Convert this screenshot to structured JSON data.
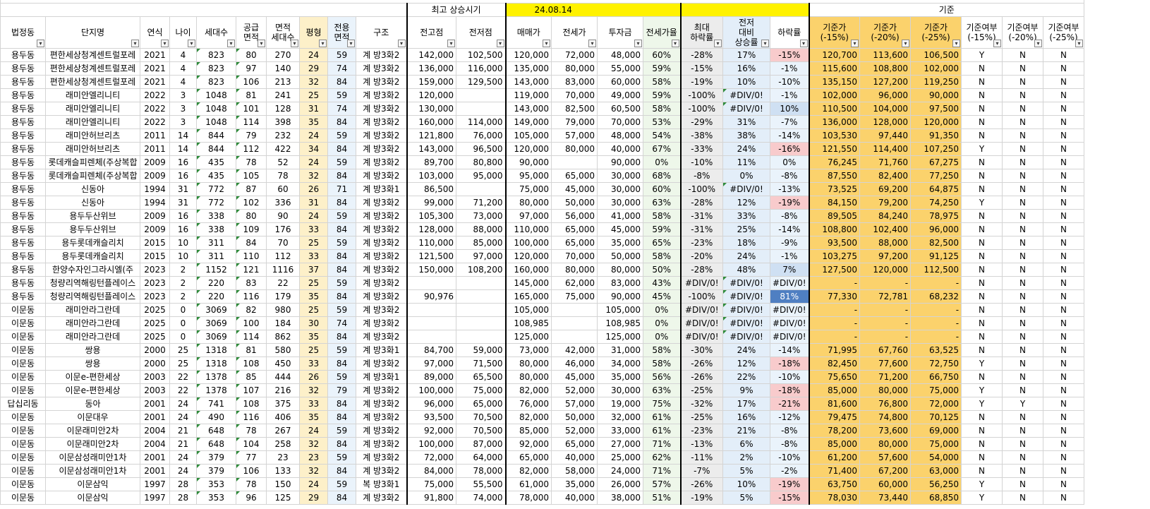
{
  "top_labels": {
    "peak_label": "최고 상승시기",
    "date": "24.08.14",
    "base_label": "기준"
  },
  "headers": [
    "법정동",
    "단지명",
    "연식",
    "나이",
    "세대수",
    "공급\n면적",
    "면적\n세대수",
    "평형",
    "전용\n면적",
    "구조",
    "전고점",
    "전저점",
    "매매가",
    "전세가",
    "투자금",
    "전세가율",
    "최대\n하락률",
    "전저\n대비\n상승률",
    "하락률",
    "기준가\n(-15%)",
    "기준가\n(-20%)",
    "기준가\n(-25%)",
    "기준여부\n(-15%)",
    "기준여부\n(-20%)",
    "기준여부\n(-25%)"
  ],
  "filter_icon": "filter-dropdown-icon",
  "colors": {
    "pyeong": "#fdf0c9",
    "jeonyong": "#eaf3fb",
    "highlight": "#fff200",
    "ratio": "#eef7ea",
    "base": "#fbd26c",
    "drop_pink": "#f8cbcc",
    "drop_blue": "#cfe0f3",
    "drop_dark": "#4f7fc2"
  },
  "rows": [
    [
      "용두동",
      "편한세상청계센트럴포레",
      "2021",
      "4",
      "823",
      "80",
      "270",
      "24",
      "59",
      "계 방3화2",
      "142,000",
      "102,500",
      "120,000",
      "72,000",
      "48,000",
      "60%",
      "-28%",
      "17%",
      "-15%",
      "120,700",
      "113,600",
      "106,500",
      "Y",
      "N",
      "N"
    ],
    [
      "용두동",
      "편한세상청계센트럴포레",
      "2021",
      "4",
      "823",
      "97",
      "140",
      "29",
      "74",
      "계 방3화2",
      "136,000",
      "116,000",
      "135,000",
      "80,000",
      "55,000",
      "59%",
      "-15%",
      "16%",
      "-1%",
      "115,600",
      "108,800",
      "102,000",
      "N",
      "N",
      "N"
    ],
    [
      "용두동",
      "편한세상청계센트럴포레",
      "2021",
      "4",
      "823",
      "106",
      "213",
      "32",
      "84",
      "계 방3화2",
      "159,000",
      "129,500",
      "143,000",
      "83,000",
      "60,000",
      "58%",
      "-19%",
      "10%",
      "-10%",
      "135,150",
      "127,200",
      "119,250",
      "N",
      "N",
      "N"
    ],
    [
      "용두동",
      "래미안엘리니티",
      "2022",
      "3",
      "1048",
      "81",
      "241",
      "25",
      "59",
      "계 방3화2",
      "120,000",
      "",
      "119,000",
      "70,000",
      "49,000",
      "59%",
      "-100%",
      "#DIV/0!",
      "-1%",
      "102,000",
      "96,000",
      "90,000",
      "N",
      "N",
      "N"
    ],
    [
      "용두동",
      "래미안엘리니티",
      "2022",
      "3",
      "1048",
      "101",
      "128",
      "31",
      "74",
      "계 방3화2",
      "130,000",
      "",
      "143,000",
      "82,500",
      "60,500",
      "58%",
      "-100%",
      "#DIV/0!",
      "10%",
      "110,500",
      "104,000",
      "97,500",
      "N",
      "N",
      "N"
    ],
    [
      "용두동",
      "래미안엘리니티",
      "2022",
      "3",
      "1048",
      "114",
      "398",
      "35",
      "84",
      "계 방3화2",
      "160,000",
      "114,000",
      "149,000",
      "79,000",
      "70,000",
      "53%",
      "-29%",
      "31%",
      "-7%",
      "136,000",
      "128,000",
      "120,000",
      "N",
      "N",
      "N"
    ],
    [
      "용두동",
      "래미안허브리츠",
      "2011",
      "14",
      "844",
      "79",
      "232",
      "24",
      "59",
      "계 방3화2",
      "121,800",
      "76,000",
      "105,000",
      "57,000",
      "48,000",
      "54%",
      "-38%",
      "38%",
      "-14%",
      "103,530",
      "97,440",
      "91,350",
      "N",
      "N",
      "N"
    ],
    [
      "용두동",
      "래미안허브리츠",
      "2011",
      "14",
      "844",
      "112",
      "422",
      "34",
      "84",
      "계 방3화2",
      "143,000",
      "96,500",
      "120,000",
      "80,000",
      "40,000",
      "67%",
      "-33%",
      "24%",
      "-16%",
      "121,550",
      "114,400",
      "107,250",
      "Y",
      "N",
      "N"
    ],
    [
      "용두동",
      "롯데캐슬피렌체(주상복합",
      "2009",
      "16",
      "435",
      "78",
      "52",
      "24",
      "59",
      "계 방3화2",
      "89,700",
      "80,800",
      "90,000",
      "",
      "90,000",
      "0%",
      "-10%",
      "11%",
      "0%",
      "76,245",
      "71,760",
      "67,275",
      "N",
      "N",
      "N"
    ],
    [
      "용두동",
      "롯데캐슬피렌체(주상복합",
      "2009",
      "16",
      "435",
      "105",
      "78",
      "32",
      "84",
      "계 방3화2",
      "103,000",
      "95,000",
      "95,000",
      "65,000",
      "30,000",
      "68%",
      "-8%",
      "0%",
      "-8%",
      "87,550",
      "82,400",
      "77,250",
      "N",
      "N",
      "N"
    ],
    [
      "용두동",
      "신동아",
      "1994",
      "31",
      "772",
      "87",
      "60",
      "26",
      "71",
      "계 방3화1",
      "86,500",
      "",
      "75,000",
      "45,000",
      "30,000",
      "60%",
      "-100%",
      "#DIV/0!",
      "-13%",
      "73,525",
      "69,200",
      "64,875",
      "N",
      "N",
      "N"
    ],
    [
      "용두동",
      "신동아",
      "1994",
      "31",
      "772",
      "102",
      "336",
      "31",
      "84",
      "계 방3화2",
      "99,000",
      "71,200",
      "80,000",
      "50,000",
      "30,000",
      "63%",
      "-28%",
      "12%",
      "-19%",
      "84,150",
      "79,200",
      "74,250",
      "Y",
      "N",
      "N"
    ],
    [
      "용두동",
      "용두두산위브",
      "2009",
      "16",
      "338",
      "80",
      "90",
      "24",
      "59",
      "계 방3화2",
      "105,300",
      "73,000",
      "97,000",
      "56,000",
      "41,000",
      "58%",
      "-31%",
      "33%",
      "-8%",
      "89,505",
      "84,240",
      "78,975",
      "N",
      "N",
      "N"
    ],
    [
      "용두동",
      "용두두산위브",
      "2009",
      "16",
      "338",
      "109",
      "176",
      "33",
      "84",
      "계 방3화2",
      "128,000",
      "88,000",
      "110,000",
      "65,000",
      "45,000",
      "59%",
      "-31%",
      "25%",
      "-14%",
      "108,800",
      "102,400",
      "96,000",
      "N",
      "N",
      "N"
    ],
    [
      "용두동",
      "용두롯데캐슬리치",
      "2015",
      "10",
      "311",
      "84",
      "70",
      "25",
      "59",
      "계 방3화2",
      "110,000",
      "85,000",
      "100,000",
      "65,000",
      "35,000",
      "65%",
      "-23%",
      "18%",
      "-9%",
      "93,500",
      "88,000",
      "82,500",
      "N",
      "N",
      "N"
    ],
    [
      "용두동",
      "용두롯데캐슬리치",
      "2015",
      "10",
      "311",
      "110",
      "112",
      "33",
      "84",
      "계 방3화2",
      "121,500",
      "97,000",
      "120,000",
      "70,000",
      "50,000",
      "58%",
      "-20%",
      "24%",
      "-1%",
      "103,275",
      "97,200",
      "91,125",
      "N",
      "N",
      "N"
    ],
    [
      "용두동",
      "한양수자인그라시엘(주",
      "2023",
      "2",
      "1152",
      "121",
      "1116",
      "37",
      "84",
      "계 방3화2",
      "150,000",
      "108,200",
      "160,000",
      "80,000",
      "80,000",
      "50%",
      "-28%",
      "48%",
      "7%",
      "127,500",
      "120,000",
      "112,500",
      "N",
      "N",
      "N"
    ],
    [
      "용두동",
      "청량리역해링턴플레이스",
      "2023",
      "2",
      "220",
      "83",
      "22",
      "25",
      "59",
      "계 방3화2",
      "",
      "",
      "145,000",
      "62,000",
      "83,000",
      "43%",
      "#DIV/0!",
      "#DIV/0!",
      "#DIV/0!",
      "-",
      "-",
      "-",
      "N",
      "N",
      "N"
    ],
    [
      "용두동",
      "청량리역해링턴플레이스",
      "2023",
      "2",
      "220",
      "116",
      "179",
      "35",
      "84",
      "계 방3화2",
      "90,976",
      "",
      "165,000",
      "75,000",
      "90,000",
      "45%",
      "-100%",
      "#DIV/0!",
      "81%",
      "77,330",
      "72,781",
      "68,232",
      "N",
      "N",
      "N"
    ],
    [
      "이문동",
      "래미안라그란데",
      "2025",
      "0",
      "3069",
      "82",
      "980",
      "25",
      "59",
      "계 방3화2",
      "",
      "",
      "105,000",
      "",
      "105,000",
      "0%",
      "#DIV/0!",
      "#DIV/0!",
      "#DIV/0!",
      "-",
      "-",
      "-",
      "N",
      "N",
      "N"
    ],
    [
      "이문동",
      "래미안라그란데",
      "2025",
      "0",
      "3069",
      "100",
      "184",
      "30",
      "74",
      "계 방3화2",
      "",
      "",
      "108,985",
      "",
      "108,985",
      "0%",
      "#DIV/0!",
      "#DIV/0!",
      "#DIV/0!",
      "-",
      "-",
      "-",
      "N",
      "N",
      "N"
    ],
    [
      "이문동",
      "래미안라그란데",
      "2025",
      "0",
      "3069",
      "114",
      "862",
      "35",
      "84",
      "계 방3화2",
      "",
      "",
      "125,000",
      "",
      "125,000",
      "0%",
      "#DIV/0!",
      "#DIV/0!",
      "#DIV/0!",
      "-",
      "-",
      "-",
      "N",
      "N",
      "N"
    ],
    [
      "이문동",
      "쌍용",
      "2000",
      "25",
      "1318",
      "81",
      "580",
      "25",
      "59",
      "계 방3화1",
      "84,700",
      "59,000",
      "73,000",
      "42,000",
      "31,000",
      "58%",
      "-30%",
      "24%",
      "-14%",
      "71,995",
      "67,760",
      "63,525",
      "N",
      "N",
      "N"
    ],
    [
      "이문동",
      "쌍용",
      "2000",
      "25",
      "1318",
      "108",
      "450",
      "33",
      "84",
      "계 방3화2",
      "97,000",
      "71,500",
      "80,000",
      "46,000",
      "34,000",
      "58%",
      "-26%",
      "12%",
      "-18%",
      "82,450",
      "77,600",
      "72,750",
      "Y",
      "N",
      "N"
    ],
    [
      "이문동",
      "이문e-편한세상",
      "2003",
      "22",
      "1378",
      "85",
      "444",
      "26",
      "59",
      "계 방3화1",
      "89,000",
      "65,500",
      "80,000",
      "45,000",
      "35,000",
      "56%",
      "-26%",
      "22%",
      "-10%",
      "75,650",
      "71,200",
      "66,750",
      "N",
      "N",
      "N"
    ],
    [
      "이문동",
      "이문e-편한세상",
      "2003",
      "22",
      "1378",
      "107",
      "216",
      "32",
      "79",
      "계 방3화2",
      "100,000",
      "75,000",
      "82,000",
      "52,000",
      "30,000",
      "63%",
      "-25%",
      "9%",
      "-18%",
      "85,000",
      "80,000",
      "75,000",
      "Y",
      "N",
      "N"
    ],
    [
      "답십리동",
      "동아",
      "2001",
      "24",
      "741",
      "108",
      "375",
      "33",
      "84",
      "계 방3화2",
      "96,000",
      "65,000",
      "76,000",
      "57,000",
      "19,000",
      "75%",
      "-32%",
      "17%",
      "-21%",
      "81,600",
      "76,800",
      "72,000",
      "Y",
      "Y",
      "N"
    ],
    [
      "이문동",
      "이문대우",
      "2001",
      "24",
      "490",
      "116",
      "406",
      "35",
      "84",
      "계 방3화2",
      "93,500",
      "70,500",
      "82,000",
      "50,000",
      "32,000",
      "61%",
      "-25%",
      "16%",
      "-12%",
      "79,475",
      "74,800",
      "70,125",
      "N",
      "N",
      "N"
    ],
    [
      "이문동",
      "이문래미안2차",
      "2004",
      "21",
      "648",
      "78",
      "267",
      "24",
      "59",
      "계 방3화2",
      "92,000",
      "70,500",
      "85,000",
      "52,000",
      "33,000",
      "61%",
      "-23%",
      "21%",
      "-8%",
      "78,200",
      "73,600",
      "69,000",
      "N",
      "N",
      "N"
    ],
    [
      "이문동",
      "이문래미안2차",
      "2004",
      "21",
      "648",
      "104",
      "258",
      "32",
      "84",
      "계 방3화2",
      "100,000",
      "87,000",
      "92,000",
      "65,000",
      "27,000",
      "71%",
      "-13%",
      "6%",
      "-8%",
      "85,000",
      "80,000",
      "75,000",
      "N",
      "N",
      "N"
    ],
    [
      "이문동",
      "이문삼성래미안1차",
      "2001",
      "24",
      "379",
      "77",
      "23",
      "23",
      "59",
      "계 방3화2",
      "72,000",
      "64,000",
      "65,000",
      "40,000",
      "25,000",
      "62%",
      "-11%",
      "2%",
      "-10%",
      "61,200",
      "57,600",
      "54,000",
      "N",
      "N",
      "N"
    ],
    [
      "이문동",
      "이문삼성래미안1차",
      "2001",
      "24",
      "379",
      "106",
      "133",
      "32",
      "84",
      "계 방3화2",
      "84,000",
      "78,000",
      "82,000",
      "58,000",
      "24,000",
      "71%",
      "-7%",
      "5%",
      "-2%",
      "71,400",
      "67,200",
      "63,000",
      "N",
      "N",
      "N"
    ],
    [
      "이문동",
      "이문삼익",
      "1997",
      "28",
      "353",
      "78",
      "150",
      "24",
      "59",
      "복 방3화1",
      "75,000",
      "55,500",
      "61,000",
      "35,000",
      "26,000",
      "57%",
      "-26%",
      "10%",
      "-19%",
      "63,750",
      "60,000",
      "56,250",
      "Y",
      "N",
      "N"
    ],
    [
      "이문동",
      "이문삼익",
      "1997",
      "28",
      "353",
      "96",
      "125",
      "29",
      "84",
      "계 방3화2",
      "91,800",
      "74,000",
      "78,000",
      "40,000",
      "38,000",
      "51%",
      "-19%",
      "5%",
      "-15%",
      "78,030",
      "73,440",
      "68,850",
      "Y",
      "N",
      "N"
    ]
  ]
}
